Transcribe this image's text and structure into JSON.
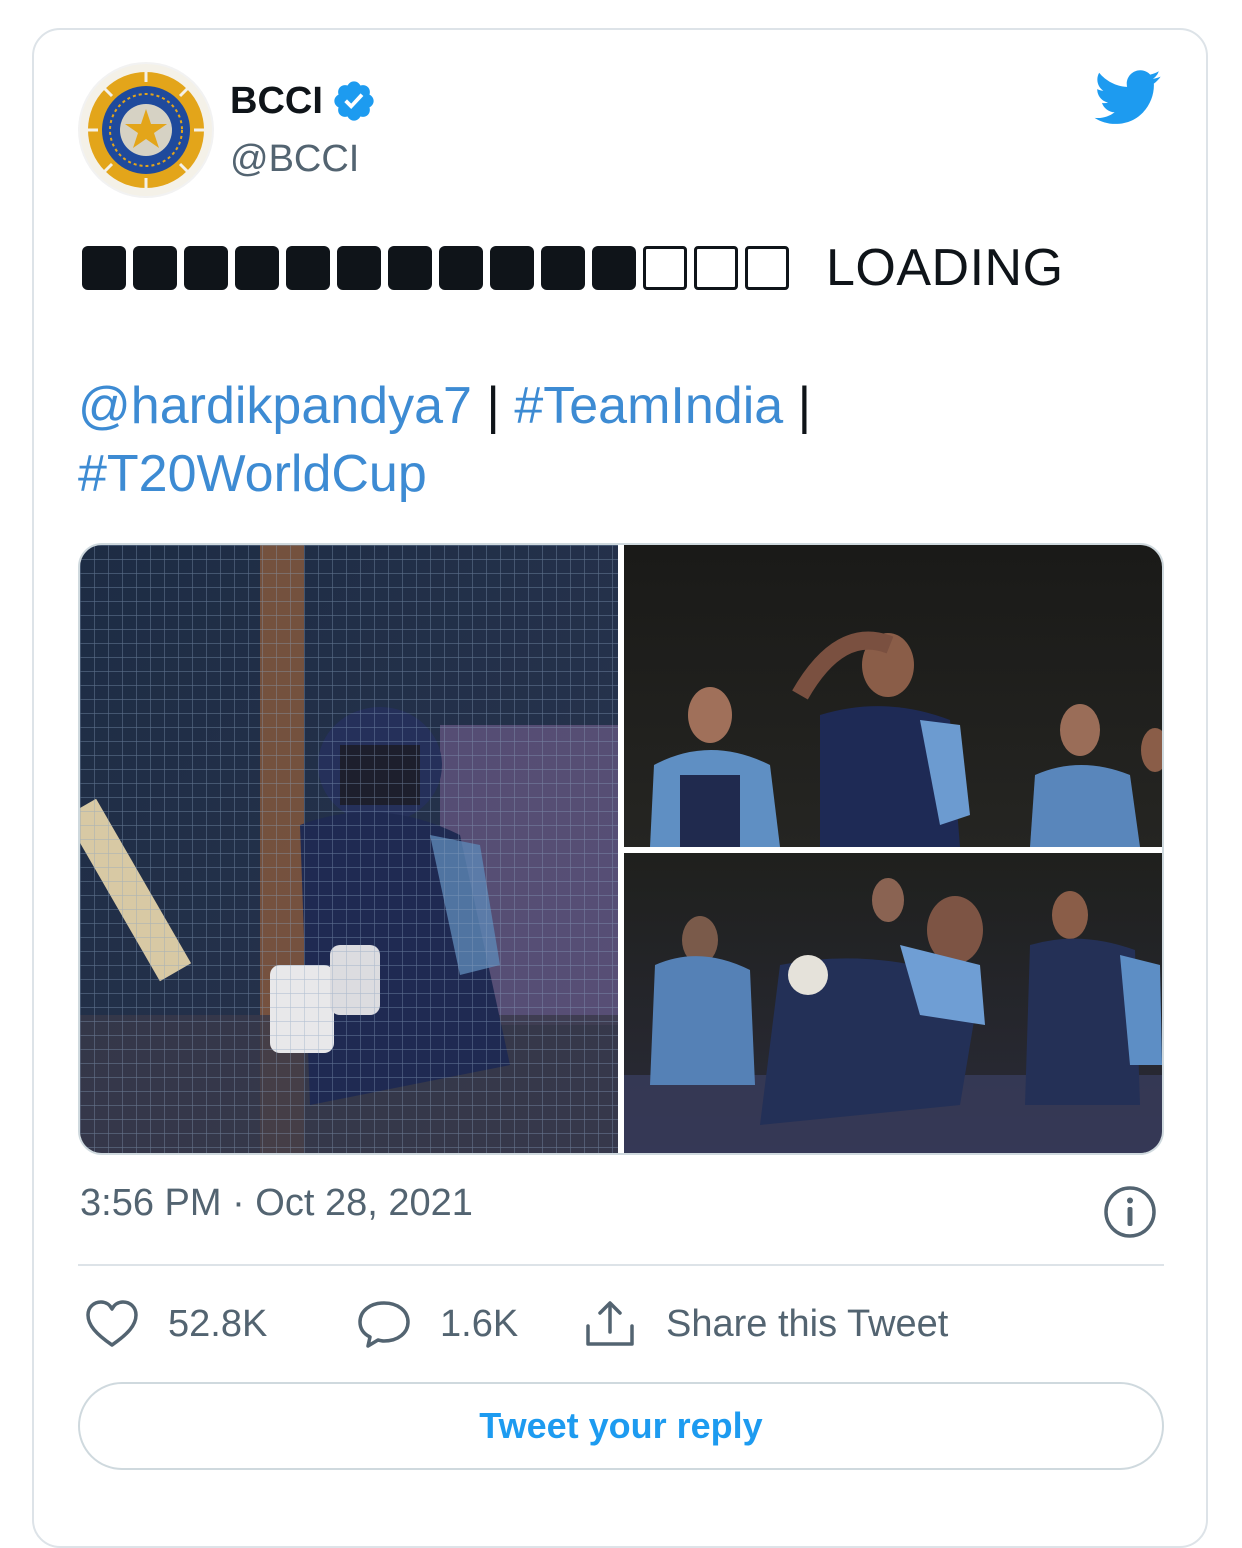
{
  "author": {
    "name": "BCCI",
    "handle": "@BCCI",
    "verified": true,
    "avatar_icon": "bcci-logo-icon"
  },
  "brand_icon": "twitter-bird-icon",
  "colors": {
    "link": "#3d8bd3",
    "twitter_blue": "#1d9bf0",
    "verified": "#1d9bf0",
    "text": "#0f1419",
    "secondary_text": "#536471"
  },
  "tweet": {
    "progress": {
      "filled": 11,
      "total": 14
    },
    "loading_label": "LOADING",
    "mention": "@hardikpandya7",
    "separator1": " | ",
    "hashtag1": "#TeamIndia",
    "separator2": " |",
    "hashtag2": "#T20WorldCup"
  },
  "media": {
    "count": 3,
    "layout": "1 large left, 2 stacked right"
  },
  "timestamp": "3:56 PM · Oct 28, 2021",
  "actions": {
    "likes": "52.8K",
    "replies": "1.6K",
    "share_label": "Share this Tweet"
  },
  "reply_button_label": "Tweet your reply"
}
